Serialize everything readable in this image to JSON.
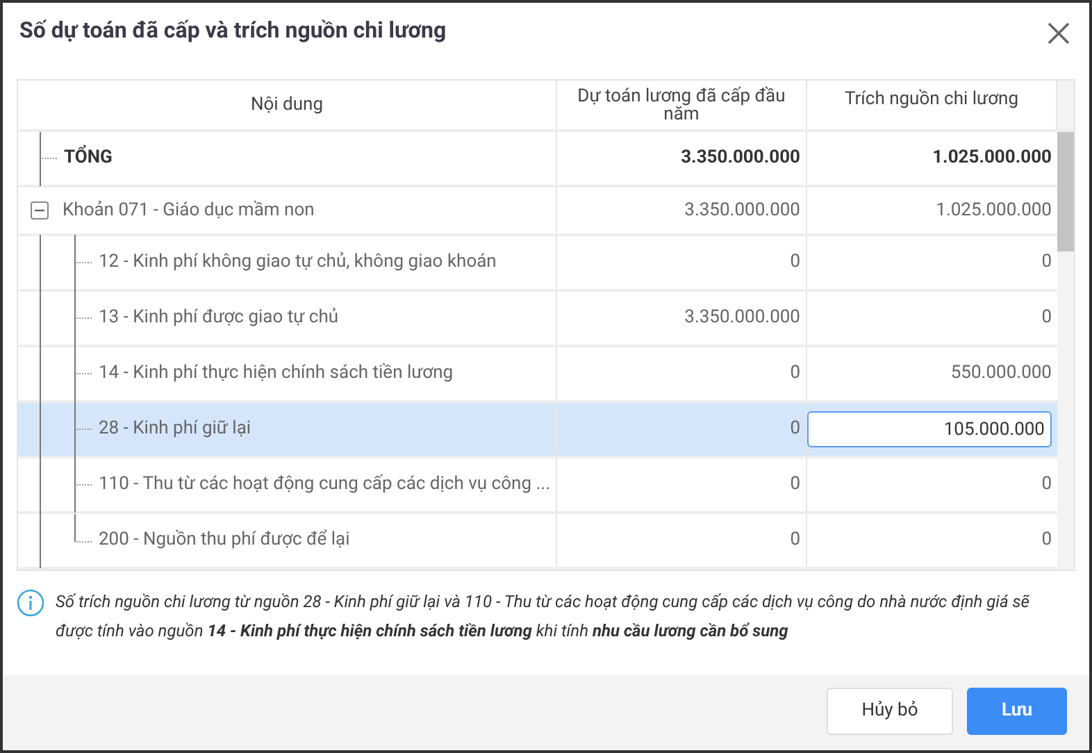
{
  "dialog": {
    "title": "Số dự toán đã cấp và trích nguồn chi lương"
  },
  "table": {
    "columns": [
      "Nội dung",
      "Dự toán lương đã cấp đầu năm",
      "Trích nguồn chi lương"
    ],
    "rows": [
      {
        "kind": "total",
        "label": "TỔNG",
        "allocated": "3.350.000.000",
        "extracted": "1.025.000.000"
      },
      {
        "kind": "group",
        "label": "Khoản 071 - Giáo dục mầm non",
        "allocated": "3.350.000.000",
        "extracted": "1.025.000.000",
        "expanded": true,
        "children": [
          {
            "label": "12 - Kinh phí không giao tự chủ, không giao khoán",
            "allocated": "0",
            "extracted": "0",
            "selected": false,
            "editing": false
          },
          {
            "label": "13 - Kinh phí được giao tự chủ",
            "allocated": "3.350.000.000",
            "extracted": "0",
            "selected": false,
            "editing": false
          },
          {
            "label": "14 - Kinh phí thực hiện chính sách tiền lương",
            "allocated": "0",
            "extracted": "550.000.000",
            "selected": false,
            "editing": false
          },
          {
            "label": "28 - Kinh phí giữ lại",
            "allocated": "0",
            "extracted": "105.000.000",
            "selected": true,
            "editing": true
          },
          {
            "label": "110 - Thu từ các hoạt động cung cấp các dịch vụ công ...",
            "allocated": "0",
            "extracted": "0",
            "selected": false,
            "editing": false
          },
          {
            "label": "200 - Nguồn thu phí được để lại",
            "allocated": "0",
            "extracted": "0",
            "selected": false,
            "editing": false
          }
        ]
      }
    ]
  },
  "note": "Số trích nguồn chi lương từ nguồn 28 - Kinh phí giữ lại và 110 - Thu từ các hoạt động cung cấp các dịch vụ công do nhà nước định giá sẽ được tính vào nguồn **14 - Kinh phí thực hiện chính sách tiền lương** khi tính **nhu cầu lương cần bổ sung**",
  "buttons": [
    {
      "label": "Hủy bỏ",
      "kind": "secondary"
    },
    {
      "label": "Lưu",
      "kind": "primary"
    }
  ]
}
